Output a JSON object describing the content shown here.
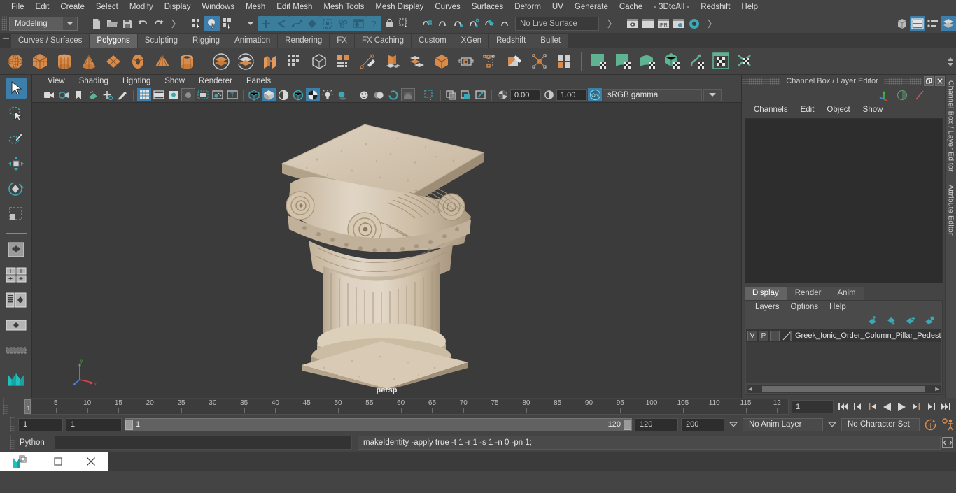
{
  "menubar": {
    "items": [
      "File",
      "Edit",
      "Create",
      "Select",
      "Modify",
      "Display",
      "Windows",
      "Mesh",
      "Edit Mesh",
      "Mesh Tools",
      "Mesh Display",
      "Curves",
      "Surfaces",
      "Deform",
      "UV",
      "Generate",
      "Cache",
      "- 3DtoAll -",
      "Redshift",
      "Help"
    ]
  },
  "statusline": {
    "mode": "Modeling",
    "live_surface": "No Live Surface",
    "icons": [
      "new-scene-icon",
      "open-scene-icon",
      "save-scene-icon",
      "undo-icon",
      "redo-icon",
      "select-by-hierarchy-icon",
      "select-by-object-icon",
      "select-by-component-icon",
      "mask-points-icon",
      "mask-lines-icon",
      "mask-curves-icon",
      "mask-surfaces-icon",
      "mask-deformations-icon",
      "mask-dynamics-icon",
      "mask-rendering-icon",
      "mask-misc-icon",
      "lock-icon",
      "highlight-selection-icon",
      "snap-grid-icon",
      "snap-curve-icon",
      "snap-point-icon",
      "snap-projected-icon",
      "snap-view-plane-icon",
      "magnet-icon",
      "make-live-icon",
      "render-view-icon",
      "render-current-frame-icon",
      "ipr-render-icon",
      "render-settings-icon",
      "hypershade-icon",
      "show-hide-editors-icon",
      "show-attribute-editor-icon",
      "show-tool-settings-icon",
      "show-channel-box-icon"
    ]
  },
  "shelf": {
    "tabs": [
      "Curves / Surfaces",
      "Polygons",
      "Sculpting",
      "Rigging",
      "Animation",
      "Rendering",
      "FX",
      "FX Caching",
      "Custom",
      "XGen",
      "Redshift",
      "Bullet"
    ],
    "active_tab": "Polygons",
    "buttons": [
      "poly-sphere-icon",
      "poly-cube-icon",
      "poly-cylinder-icon",
      "poly-cone-icon",
      "poly-plane-icon",
      "poly-torus-icon",
      "poly-pyramid-icon",
      "poly-pipe-icon",
      "boolean-union-icon",
      "boolean-difference-icon",
      "combine-icon",
      "separate-icon",
      "extract-icon",
      "smooth-icon",
      "reduce-icon",
      "create-polygon-icon",
      "extrude-icon",
      "bevel-icon",
      "bridge-icon",
      "append-polygon-icon",
      "insert-edge-loop-icon",
      "multi-cut-icon",
      "target-weld-icon",
      "quad-draw-icon",
      "uv-planar-icon",
      "uv-cylindrical-icon",
      "uv-spherical-icon",
      "uv-automatic-icon",
      "uv-cut-icon",
      "uv-editor-icon",
      "uv-unfold-icon"
    ]
  },
  "toolbox": {
    "items": [
      "select-tool-icon",
      "lasso-select-tool-icon",
      "paint-select-tool-icon",
      "move-tool-icon",
      "rotate-tool-icon",
      "scale-tool-icon",
      "last-tool-icon",
      "layout-single-icon",
      "layout-four-view-icon",
      "layout-persp-outliner-icon",
      "layout-hypergraph-icon",
      "maya-logo-icon"
    ]
  },
  "viewport": {
    "menus": [
      "View",
      "Shading",
      "Lighting",
      "Show",
      "Renderer",
      "Panels"
    ],
    "toolbar_icons": [
      "select-camera-icon",
      "camera-attributes-icon",
      "bookmark-icon",
      "image-plane-icon",
      "two-d-pan-zoom-icon",
      "grease-pencil-icon",
      "grid-toggle-icon",
      "film-gate-icon",
      "resolution-gate-icon",
      "gate-mask-icon",
      "field-chart-icon",
      "safe-action-icon",
      "safe-title-icon",
      "wireframe-icon",
      "smooth-shade-icon",
      "shade-all-icon",
      "wireframe-on-shaded-icon",
      "texture-toggle-icon",
      "lights-icon",
      "shadows-icon",
      "screen-space-ao-icon",
      "motion-blur-icon",
      "multisample-icon",
      "depth-of-field-icon",
      "isolate-select-icon",
      "xray-icon",
      "xray-joints-icon",
      "xray-active-components-icon"
    ],
    "exposure": "0.00",
    "gamma": "1.00",
    "gamma_toggle": "ON",
    "color_space": "sRGB gamma",
    "camera_label": "persp",
    "axis": {
      "x": "x",
      "y": "y",
      "z": "z"
    }
  },
  "rightpanel": {
    "title": "Channel Box / Layer Editor",
    "window_buttons": [
      "restore-icon",
      "close-icon"
    ],
    "channel_menus": [
      "Channels",
      "Edit",
      "Object",
      "Show"
    ],
    "layer_tabs": [
      "Display",
      "Render",
      "Anim"
    ],
    "layer_tab_active": "Display",
    "layer_menus": [
      "Layers",
      "Options",
      "Help"
    ],
    "layers": [
      {
        "visible": "V",
        "playback": "P",
        "shading": "",
        "name": "Greek_Ionic_Order_Column_Pillar_Pedestal_"
      }
    ],
    "side_tabs": [
      "Channel Box / Layer Editor",
      "Attribute Editor"
    ]
  },
  "timeslider": {
    "tick_labels": [
      "5",
      "10",
      "15",
      "20",
      "25",
      "30",
      "35",
      "40",
      "45",
      "50",
      "55",
      "60",
      "65",
      "70",
      "75",
      "80",
      "85",
      "90",
      "95",
      "100",
      "105",
      "110",
      "115",
      "12"
    ],
    "current_frame": "1",
    "current_frame_field": "1",
    "playback_buttons": [
      "go-to-start-icon",
      "step-back-keyframe-icon",
      "step-back-frame-icon",
      "play-backwards-icon",
      "play-forwards-icon",
      "step-forward-frame-icon",
      "step-forward-keyframe-icon",
      "go-to-end-icon"
    ]
  },
  "rangeslider": {
    "anim_start": "1",
    "range_start": "1",
    "bar_start": "1",
    "bar_end": "120",
    "range_end": "120",
    "anim_end": "200",
    "anim_layer": "No Anim Layer",
    "character_set": "No Character Set",
    "right_icons": [
      "auto-keyframe-icon",
      "animation-preferences-icon"
    ]
  },
  "commandline": {
    "language": "Python",
    "input_value": "",
    "output": "makeIdentity -apply true -t 1 -r 1 -s 1 -n 0 -pn 1;",
    "script-editor-icon": "script-editor-icon"
  },
  "taskbar": {
    "items": [
      "maya-app-icon",
      "restore-window-icon",
      "minimize-window-icon",
      "close-window-icon"
    ]
  },
  "colors": {
    "accent_blue": "#3d7faa",
    "teal": "#3aa9b5",
    "orange": "#e08b46",
    "green": "#5fb392",
    "panel_bg": "#444444",
    "viewport_bg": "#3b3b3b",
    "model_stone": "#cdbba6"
  }
}
